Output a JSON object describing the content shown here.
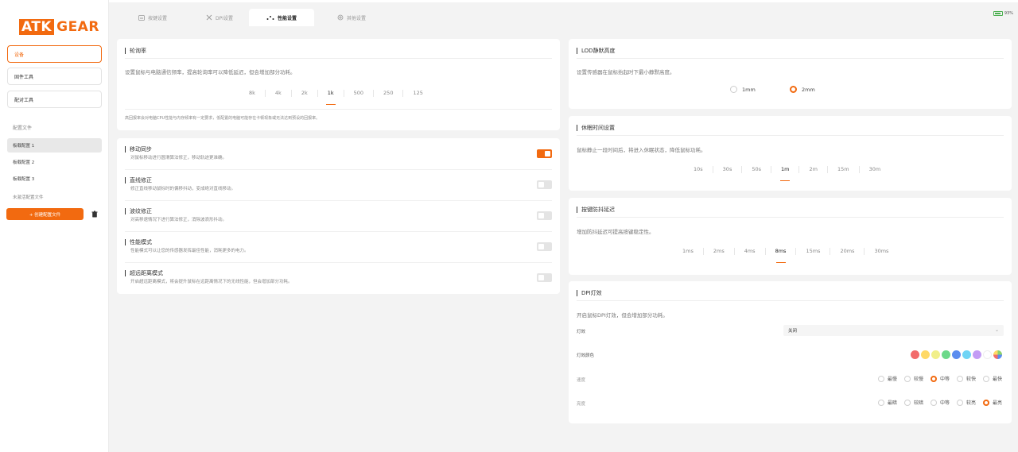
{
  "brand": {
    "logo_box": "ATK",
    "logo_text": "GEAR"
  },
  "sidebar": {
    "nav": [
      "设备",
      "固件工具",
      "配对工具"
    ],
    "config_label": "配置文件",
    "configs": [
      "板载配置 1",
      "板载配置 2",
      "板载配置 3"
    ],
    "inactive_label": "未激活配置文件",
    "new_config": "+ 创建配置文件"
  },
  "tabs": [
    "按键设置",
    "DPI设置",
    "性能设置",
    "其他设置"
  ],
  "battery": {
    "percent": "93%",
    "level": 0.93
  },
  "polling": {
    "title": "轮询率",
    "desc": "设置鼠标与电脑通信频率，提高轮询率可以降低延迟，但会增加部分功耗。",
    "options": [
      "8k",
      "4k",
      "2k",
      "1k",
      "500",
      "250",
      "125"
    ],
    "selected": "1k",
    "note": "高回报率会对电脑CPU性能与内存频率有一定要求，低配置的电脑可能存在卡顿现象或无法达到预设的回报率。"
  },
  "features": [
    {
      "title": "移动同步",
      "desc": "对鼠标移动进行圆滑算法修正，移动轨迹更准确。",
      "on": true
    },
    {
      "title": "直线修正",
      "desc": "修正直线移动鼠标时的偏移抖动，变成绝对直线移动。",
      "on": false
    },
    {
      "title": "波纹修正",
      "desc": "对高移速情况下进行算法修正，消除波浪形抖动。",
      "on": false
    },
    {
      "title": "性能模式",
      "desc": "性能模式可以让您的传感器发挥最佳性能，消耗更多的电力。",
      "on": false
    },
    {
      "title": "超远距离模式",
      "desc": "开启超远距离模式，将会提升鼠标在远距离情况下的无线性能，但会增加部分功耗。",
      "on": false
    }
  ],
  "lod": {
    "title": "LOD静默高度",
    "desc": "设置传感器在鼠标抬起时下最小静默高度。",
    "options": [
      "1mm",
      "2mm"
    ],
    "selected": "2mm"
  },
  "sleep": {
    "title": "休眠时间设置",
    "desc": "鼠标静止一段时间后，将进入休眠状态，降低鼠标功耗。",
    "options": [
      "10s",
      "30s",
      "50s",
      "1m",
      "2m",
      "15m",
      "30m"
    ],
    "selected": "1m"
  },
  "debounce": {
    "title": "按键防抖延迟",
    "desc": "增加防抖延迟可提高按键稳定性。",
    "options": [
      "1ms",
      "2ms",
      "4ms",
      "8ms",
      "15ms",
      "20ms",
      "30ms"
    ],
    "selected": "8ms"
  },
  "dpi_light": {
    "title": "DPI灯效",
    "desc": "开启鼠标DPI灯效，但会增加部分功耗。",
    "effect_label": "灯效",
    "effect_value": "关闭",
    "color_label": "灯效颜色",
    "colors": [
      "#f26b6b",
      "#ffd966",
      "#f1ef8a",
      "#6cd98a",
      "#5b8def",
      "#6fd4f5",
      "#c39cf5",
      "#ffffff",
      "#8fd16a"
    ],
    "speed_label": "速度",
    "speed_options": [
      "最慢",
      "较慢",
      "中等",
      "较快",
      "最快"
    ],
    "speed_selected": "中等",
    "brightness_label": "亮度",
    "brightness_options": [
      "最暗",
      "较暗",
      "中等",
      "较亮",
      "最亮"
    ],
    "brightness_selected": "最亮"
  }
}
